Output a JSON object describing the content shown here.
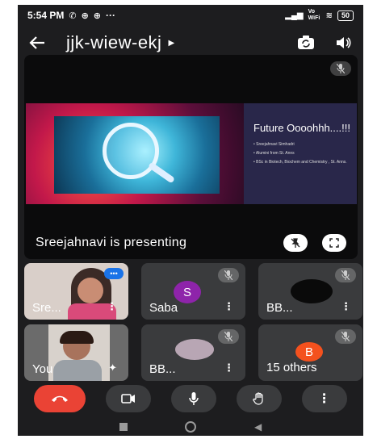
{
  "status_bar": {
    "time": "5:54 PM",
    "network": "Vo WiFi",
    "battery": "50"
  },
  "header": {
    "meeting_code": "jjk-wiew-ekj"
  },
  "presentation": {
    "slide": {
      "title": "Future Oooohhh....!!!",
      "bullets": [
        "Sreejahnavi Simhadri",
        "Alumini from St. Anns",
        "BSc in Biotech, Biochem and Chemistry , St. Anns."
      ]
    },
    "presenter_label": "Sreejahnavi is presenting"
  },
  "participants": [
    {
      "name": "Sre...",
      "type": "video",
      "muted": false
    },
    {
      "name": "Saba",
      "type": "initial",
      "initial": "S",
      "avatar_color": "#8e24aa",
      "muted": true
    },
    {
      "name": "BB...",
      "type": "photo",
      "muted": true
    },
    {
      "name": "You",
      "type": "video",
      "muted": false
    },
    {
      "name": "BB...",
      "type": "photo",
      "muted": true
    },
    {
      "name": "15 others",
      "type": "initial",
      "initial": "B",
      "avatar_color": "#f4511e",
      "muted": true
    }
  ],
  "colors": {
    "background": "#1d1d1f",
    "tile": "#3a3b3d",
    "end_call": "#ea4335",
    "accent": "#1a73e8"
  }
}
